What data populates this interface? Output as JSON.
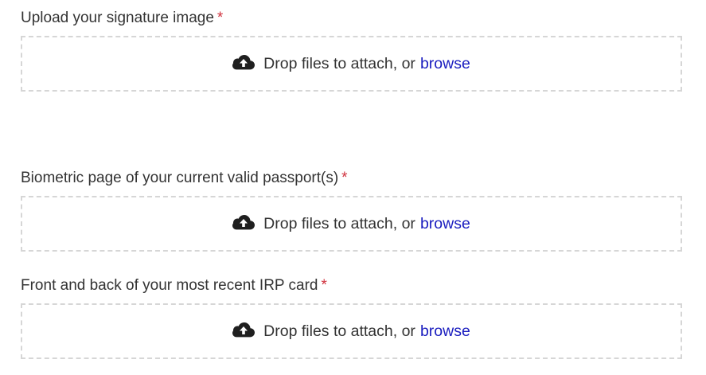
{
  "fields": [
    {
      "label": "Upload your signature image",
      "required_marker": "*",
      "drop_text": "Drop files to attach, or",
      "browse_label": "browse",
      "icon": "cloud-upload-icon"
    },
    {
      "label": "Biometric page of your current valid passport(s)",
      "required_marker": "*",
      "drop_text": "Drop files to attach, or",
      "browse_label": "browse",
      "icon": "cloud-upload-icon"
    },
    {
      "label": "Front and back of your most recent IRP card",
      "required_marker": "*",
      "drop_text": "Drop files to attach, or",
      "browse_label": "browse",
      "icon": "cloud-upload-icon"
    }
  ],
  "colors": {
    "required": "#d0313d",
    "link": "#1a1dbf",
    "border": "#d6d6d6",
    "text": "#333333"
  }
}
